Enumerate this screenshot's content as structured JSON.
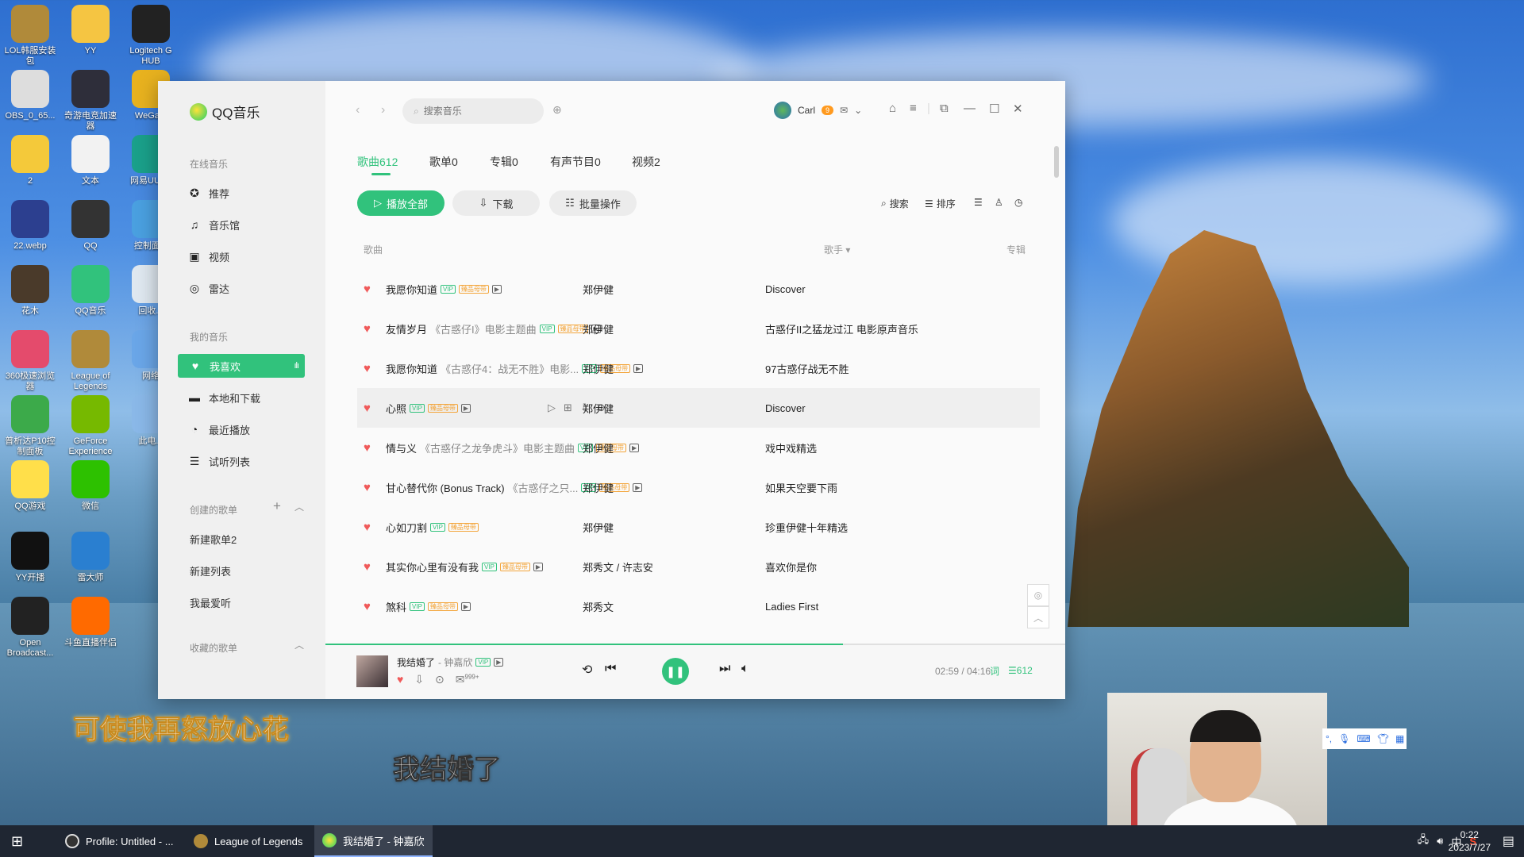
{
  "desktop_icons": [
    {
      "label": "LOL韩服安装包",
      "color": "#b08a3a"
    },
    {
      "label": "YY",
      "color": "#f5c542"
    },
    {
      "label": "Logitech G HUB",
      "color": "#222"
    },
    {
      "label": "OBS_0_65...",
      "color": "#ddd"
    },
    {
      "label": "奇游电竞加速器",
      "color": "#2e2e3a"
    },
    {
      "label": "WeGa...",
      "color": "#e8b21f"
    },
    {
      "label": "2",
      "color": "#f4c93a"
    },
    {
      "label": "文本",
      "color": "#f2f2f2"
    },
    {
      "label": "网易UU 器",
      "color": "#1aa08a"
    },
    {
      "label": "22.webp",
      "color": "#2c3f8f"
    },
    {
      "label": "QQ",
      "color": "#333"
    },
    {
      "label": "控制面...",
      "color": "#4aa0e0"
    },
    {
      "label": "花木",
      "color": "#4a3a2a"
    },
    {
      "label": "QQ音乐",
      "color": "#31c27c"
    },
    {
      "label": "回收...",
      "color": "#dfe8f0"
    },
    {
      "label": "360极速浏览器",
      "color": "#e44b6c"
    },
    {
      "label": "League of Legends",
      "color": "#b08a3a"
    },
    {
      "label": "网络",
      "color": "#6aa6e8"
    },
    {
      "label": "普析达P10控制面板",
      "color": "#3caa4a"
    },
    {
      "label": "GeForce Experience",
      "color": "#76b900"
    },
    {
      "label": "此电...",
      "color": "#8ab8e8"
    },
    {
      "label": "QQ游戏",
      "color": "#ffdf4a"
    },
    {
      "label": "微信",
      "color": "#2dc100"
    },
    {
      "label": "YY开播",
      "color": "#111"
    },
    {
      "label": "雷大师",
      "color": "#2a7fd0"
    },
    {
      "label": "Open Broadcast...",
      "color": "#222"
    },
    {
      "label": "斗鱼直播伴侣",
      "color": "#ff6a00"
    }
  ],
  "app": {
    "name": "QQ音乐",
    "search_placeholder": "搜索音乐",
    "user_name": "Carl",
    "vip_badge": "9"
  },
  "sidebar": {
    "online_title": "在线音乐",
    "online_items": [
      "推荐",
      "音乐馆",
      "视频",
      "雷达"
    ],
    "mine_title": "我的音乐",
    "mine_items": [
      "我喜欢",
      "本地和下载",
      "最近播放",
      "试听列表"
    ],
    "created_title": "创建的歌单",
    "created_add": "+",
    "created_lists": [
      "新建歌单2",
      "新建列表",
      "我最爱听"
    ],
    "collected_title": "收藏的歌单",
    "active_eq": "ılı"
  },
  "tabs": [
    "歌曲612",
    "歌单0",
    "专辑0",
    "有声节目0",
    "视频2"
  ],
  "actions": {
    "play_all": "播放全部",
    "download": "下载",
    "batch": "批量操作",
    "search": "搜索",
    "sort": "排序"
  },
  "table": {
    "col_song": "歌曲",
    "col_artist": "歌手",
    "col_album": "专辑",
    "rows": [
      {
        "title": "我愿你知道",
        "sub": "",
        "artist": "郑伊健",
        "album": "Discover"
      },
      {
        "title": "友情岁月",
        "sub": "《古惑仔I》电影主题曲",
        "artist": "郑伊健",
        "album": "古惑仔II之猛龙过江 电影原声音乐"
      },
      {
        "title": "我愿你知道",
        "sub": "《古惑仔4：战无不胜》电影...",
        "artist": "郑伊健",
        "album": "97古惑仔战无不胜"
      },
      {
        "title": "心照",
        "sub": "",
        "artist": "郑伊健",
        "album": "Discover"
      },
      {
        "title": "情与义",
        "sub": "《古惑仔之龙争虎斗》电影主题曲",
        "artist": "郑伊健",
        "album": "戏中戏精选"
      },
      {
        "title": "甘心替代你 (Bonus Track)",
        "sub": "《古惑仔之只...",
        "artist": "郑伊健",
        "album": "如果天空要下雨"
      },
      {
        "title": "心如刀割",
        "sub": "",
        "artist": "郑伊健",
        "album": "珍重伊健十年精选"
      },
      {
        "title": "其实你心里有没有我",
        "sub": "",
        "artist": "郑秀文 / 许志安",
        "album": "喜欢你是你"
      },
      {
        "title": "煞科",
        "sub": "",
        "artist": "郑秀文",
        "album": "Ladies First"
      }
    ]
  },
  "tags": {
    "vip": "VIP",
    "quality": "臻品母带",
    "mv": "▶"
  },
  "player": {
    "title": "我结婚了",
    "artist": "- 钟嘉欣",
    "time": "02:59 / 04:16",
    "lyric_icon": "词",
    "count": "612",
    "comments": "999+",
    "progress": 0.7
  },
  "lyrics": {
    "line1": "可使我再怒放心花",
    "line2": "我结婚了"
  },
  "taskbar": {
    "tasks": [
      "Profile: Untitled - ...",
      "League of Legends",
      "我结婚了 - 钟嘉欣"
    ],
    "ime": "中",
    "time": "0:22",
    "date": "2023/7/27"
  }
}
